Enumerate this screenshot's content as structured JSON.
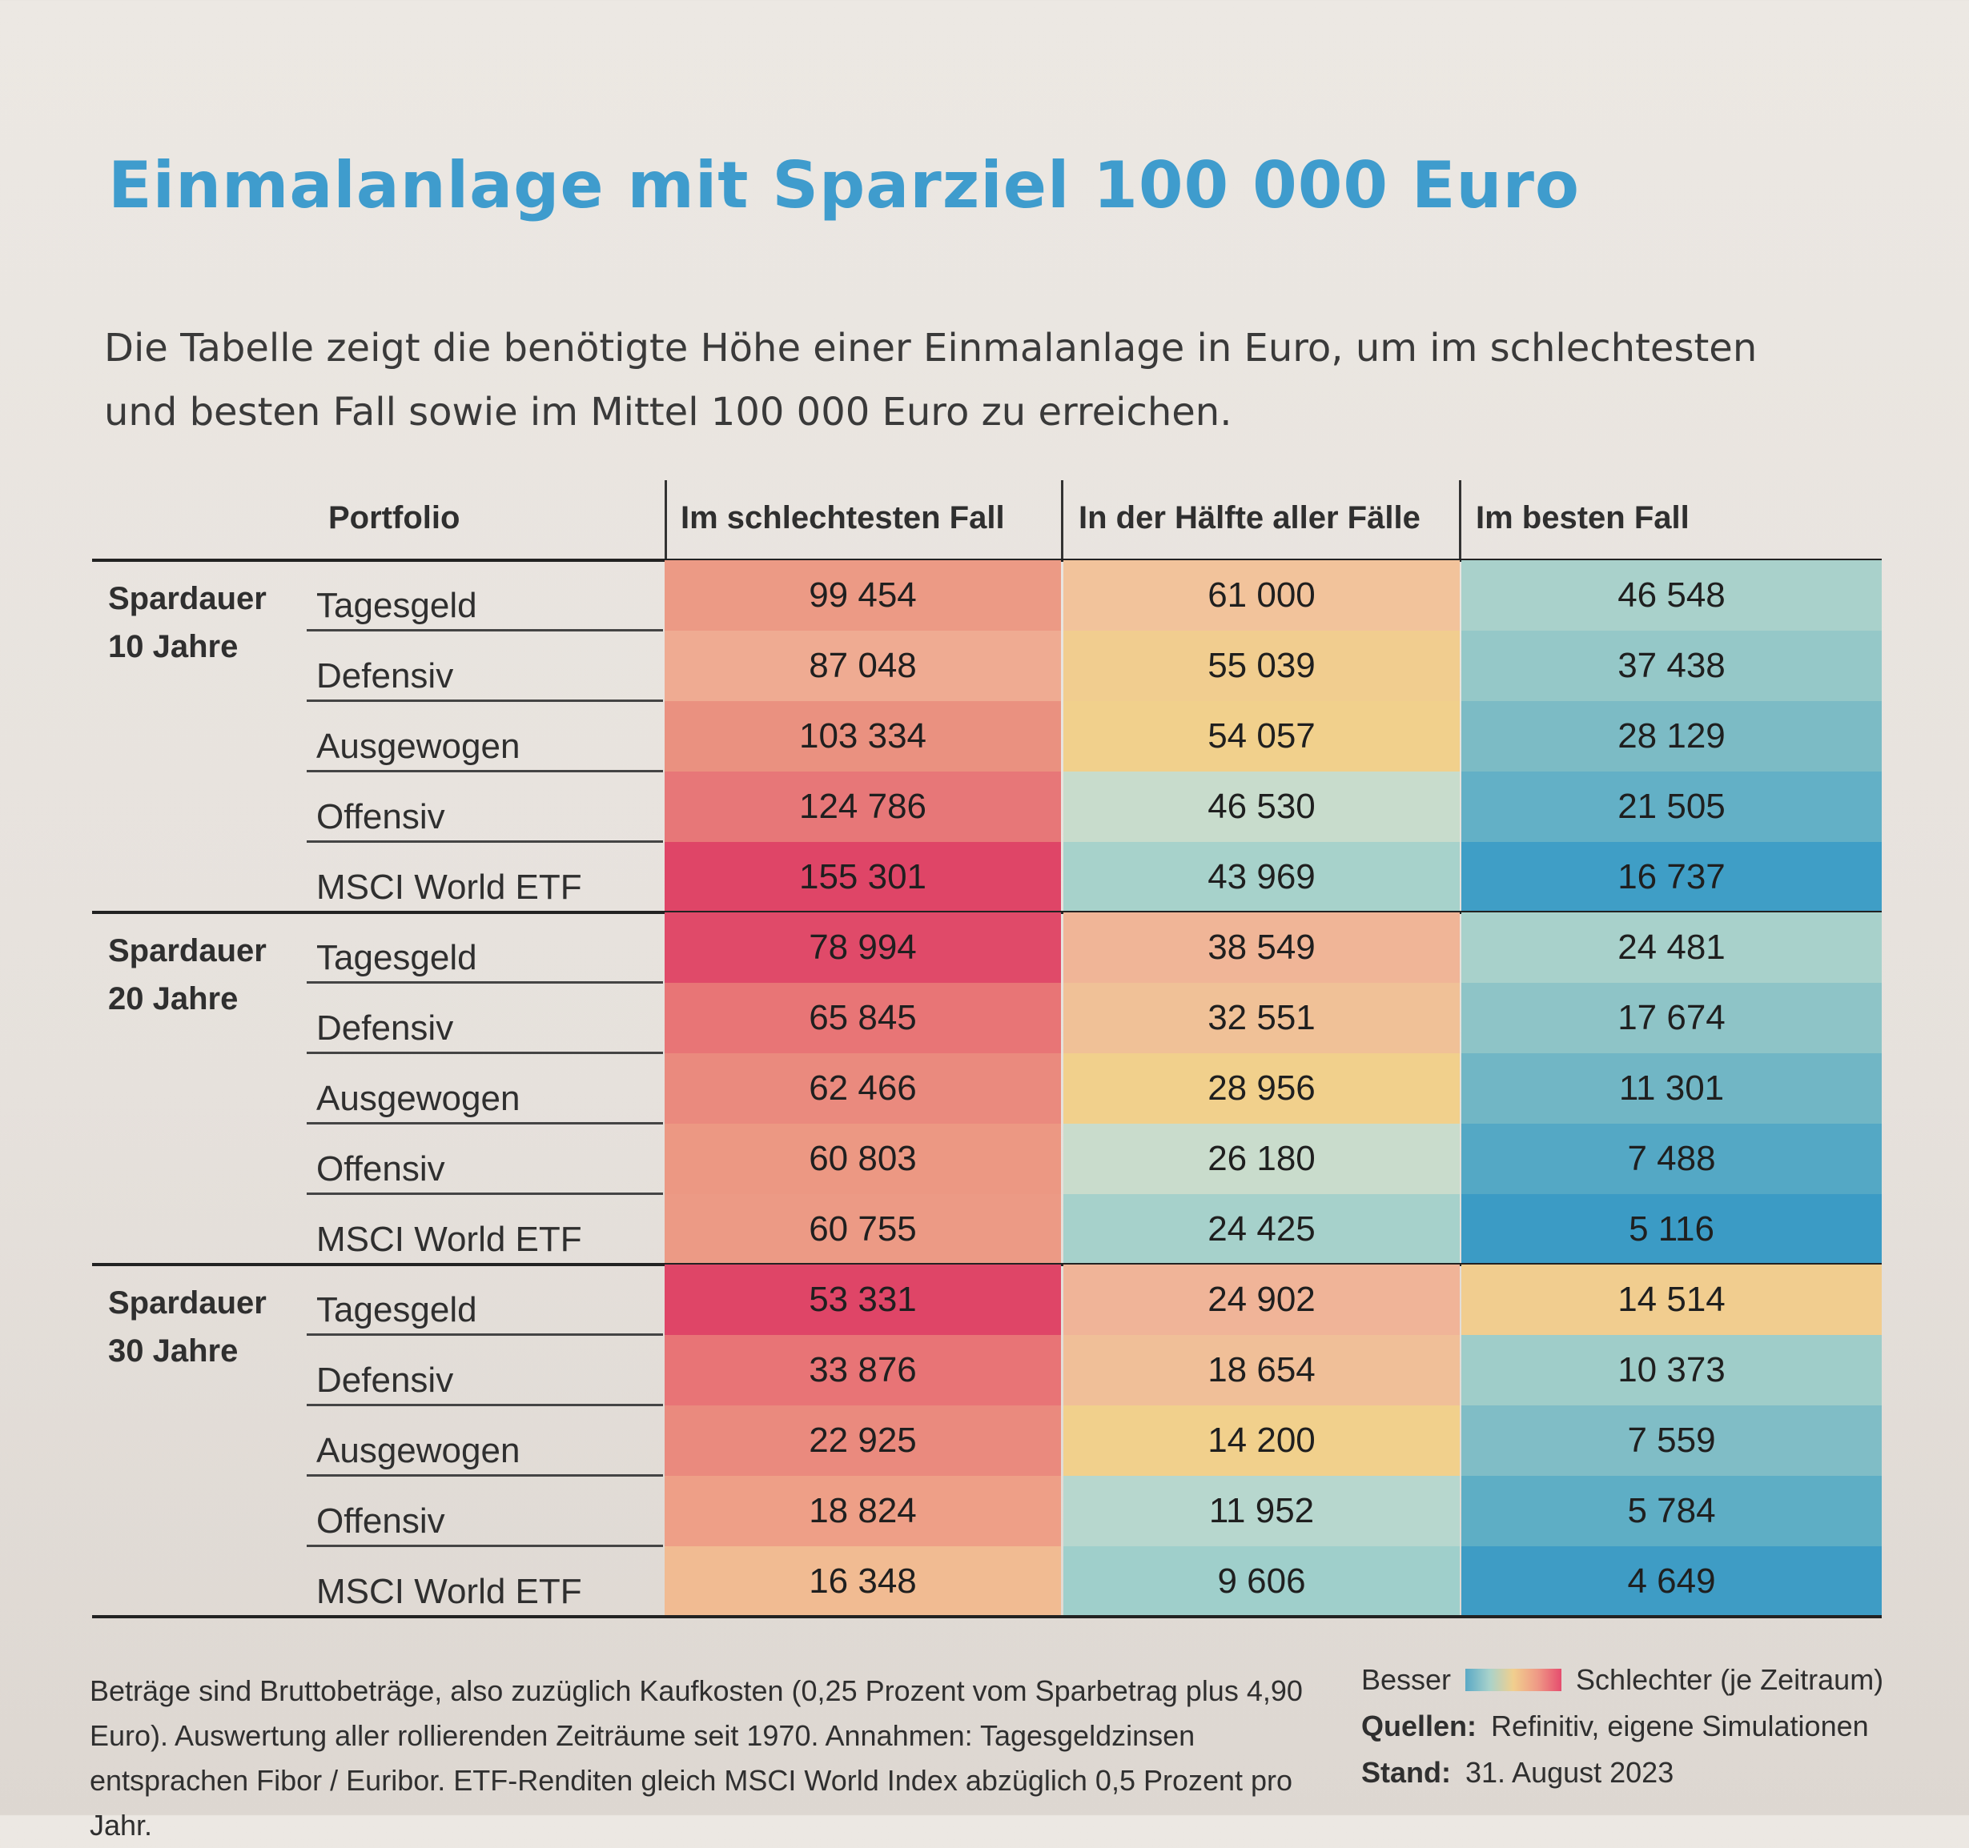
{
  "title": "Einmalanlage mit Sparziel 100 000 Euro",
  "intro": "Die Tabelle zeigt die benötigte Höhe einer Einmalanlage in Euro, um im schlechtesten und besten Fall sowie im Mittel 100 000 Euro zu erreichen.",
  "columns": [
    "Portfolio",
    "Im schlechtesten Fall",
    "In der Hälfte aller Fälle",
    "Im besten Fall"
  ],
  "groups": [
    {
      "label": "Spardauer\n10 Jahre",
      "rows": [
        {
          "portfolio": "Tagesgeld",
          "values": [
            "99 454",
            "61 000",
            "46 548"
          ],
          "colors": [
            "#ec9a85",
            "#f2c39b",
            "#a9d1cb"
          ]
        },
        {
          "portfolio": "Defensiv",
          "values": [
            "87 048",
            "55 039",
            "37 438"
          ],
          "colors": [
            "#efab92",
            "#f1cd8f",
            "#95c8c8"
          ]
        },
        {
          "portfolio": "Ausgewogen",
          "values": [
            "103 334",
            "54 057",
            "28 129"
          ],
          "colors": [
            "#ea9180",
            "#f1d08c",
            "#7cbbc5"
          ]
        },
        {
          "portfolio": "Offensiv",
          "values": [
            "124 786",
            "46 530",
            "21 505"
          ],
          "colors": [
            "#e77778",
            "#c8dccc",
            "#63b0c6"
          ]
        },
        {
          "portfolio": "MSCI World ETF",
          "values": [
            "155 301",
            "43 969",
            "16 737"
          ],
          "colors": [
            "#df4567",
            "#a7d2cb",
            "#3f9ec6"
          ]
        }
      ]
    },
    {
      "label": "Spardauer\n20 Jahre",
      "rows": [
        {
          "portfolio": "Tagesgeld",
          "values": [
            "78 994",
            "38 549",
            "24 481"
          ],
          "colors": [
            "#e04a69",
            "#f0b597",
            "#a8d1cb"
          ]
        },
        {
          "portfolio": "Defensiv",
          "values": [
            "65 845",
            "32 551",
            "17 674"
          ],
          "colors": [
            "#e87576",
            "#f0c197",
            "#8ec4c7"
          ]
        },
        {
          "portfolio": "Ausgewogen",
          "values": [
            "62 466",
            "28 956",
            "11 301"
          ],
          "colors": [
            "#ea8a7e",
            "#f1d08c",
            "#71b6c5"
          ]
        },
        {
          "portfolio": "Offensiv",
          "values": [
            "60 803",
            "26 180",
            "7 488"
          ],
          "colors": [
            "#ec9883",
            "#c9dccc",
            "#54a8c5"
          ]
        },
        {
          "portfolio": "MSCI World ETF",
          "values": [
            "60 755",
            "24 425",
            "5 116"
          ],
          "colors": [
            "#ec9a85",
            "#a6d1cb",
            "#3b9bc5"
          ]
        }
      ]
    },
    {
      "label": "Spardauer\n30 Jahre",
      "rows": [
        {
          "portfolio": "Tagesgeld",
          "values": [
            "53 331",
            "24 902",
            "14 514"
          ],
          "colors": [
            "#df4567",
            "#f0b498",
            "#f1cd8f"
          ]
        },
        {
          "portfolio": "Defensiv",
          "values": [
            "33 876",
            "18 654",
            "10 373"
          ],
          "colors": [
            "#e87476",
            "#f0bf98",
            "#9fcdc9"
          ]
        },
        {
          "portfolio": "Ausgewogen",
          "values": [
            "22 925",
            "14 200",
            "7 559"
          ],
          "colors": [
            "#ea8a7e",
            "#f1d08c",
            "#80bdc6"
          ]
        },
        {
          "portfolio": "Offensiv",
          "values": [
            "18 824",
            "11 952",
            "5 784"
          ],
          "colors": [
            "#ee9f87",
            "#b7d7ce",
            "#5eaec5"
          ]
        },
        {
          "portfolio": "MSCI World ETF",
          "values": [
            "16 348",
            "9 606",
            "4 649"
          ],
          "colors": [
            "#f1bb92",
            "#9fcfcb",
            "#3e9cc5"
          ]
        }
      ]
    }
  ],
  "footnote": "Beträge sind Bruttobeträge, also zuzüglich Kaufkosten (0,25 Prozent vom Sparbetrag plus 4,90 Euro). Auswertung aller rollierenden Zeiträume seit 1970. Annahmen: Tagesgeldzinsen entsprachen Fibor / Euribor. ETF-Renditen gleich MSCI World Index abzüglich 0,5 Prozent pro Jahr.",
  "legend": {
    "better": "Besser",
    "worse": "Schlechter (je Zeitraum)"
  },
  "sources_label": "Quellen:",
  "sources": "Refinitiv, eigene Simulationen",
  "stand_label": "Stand:",
  "stand": "31. August 2023"
}
